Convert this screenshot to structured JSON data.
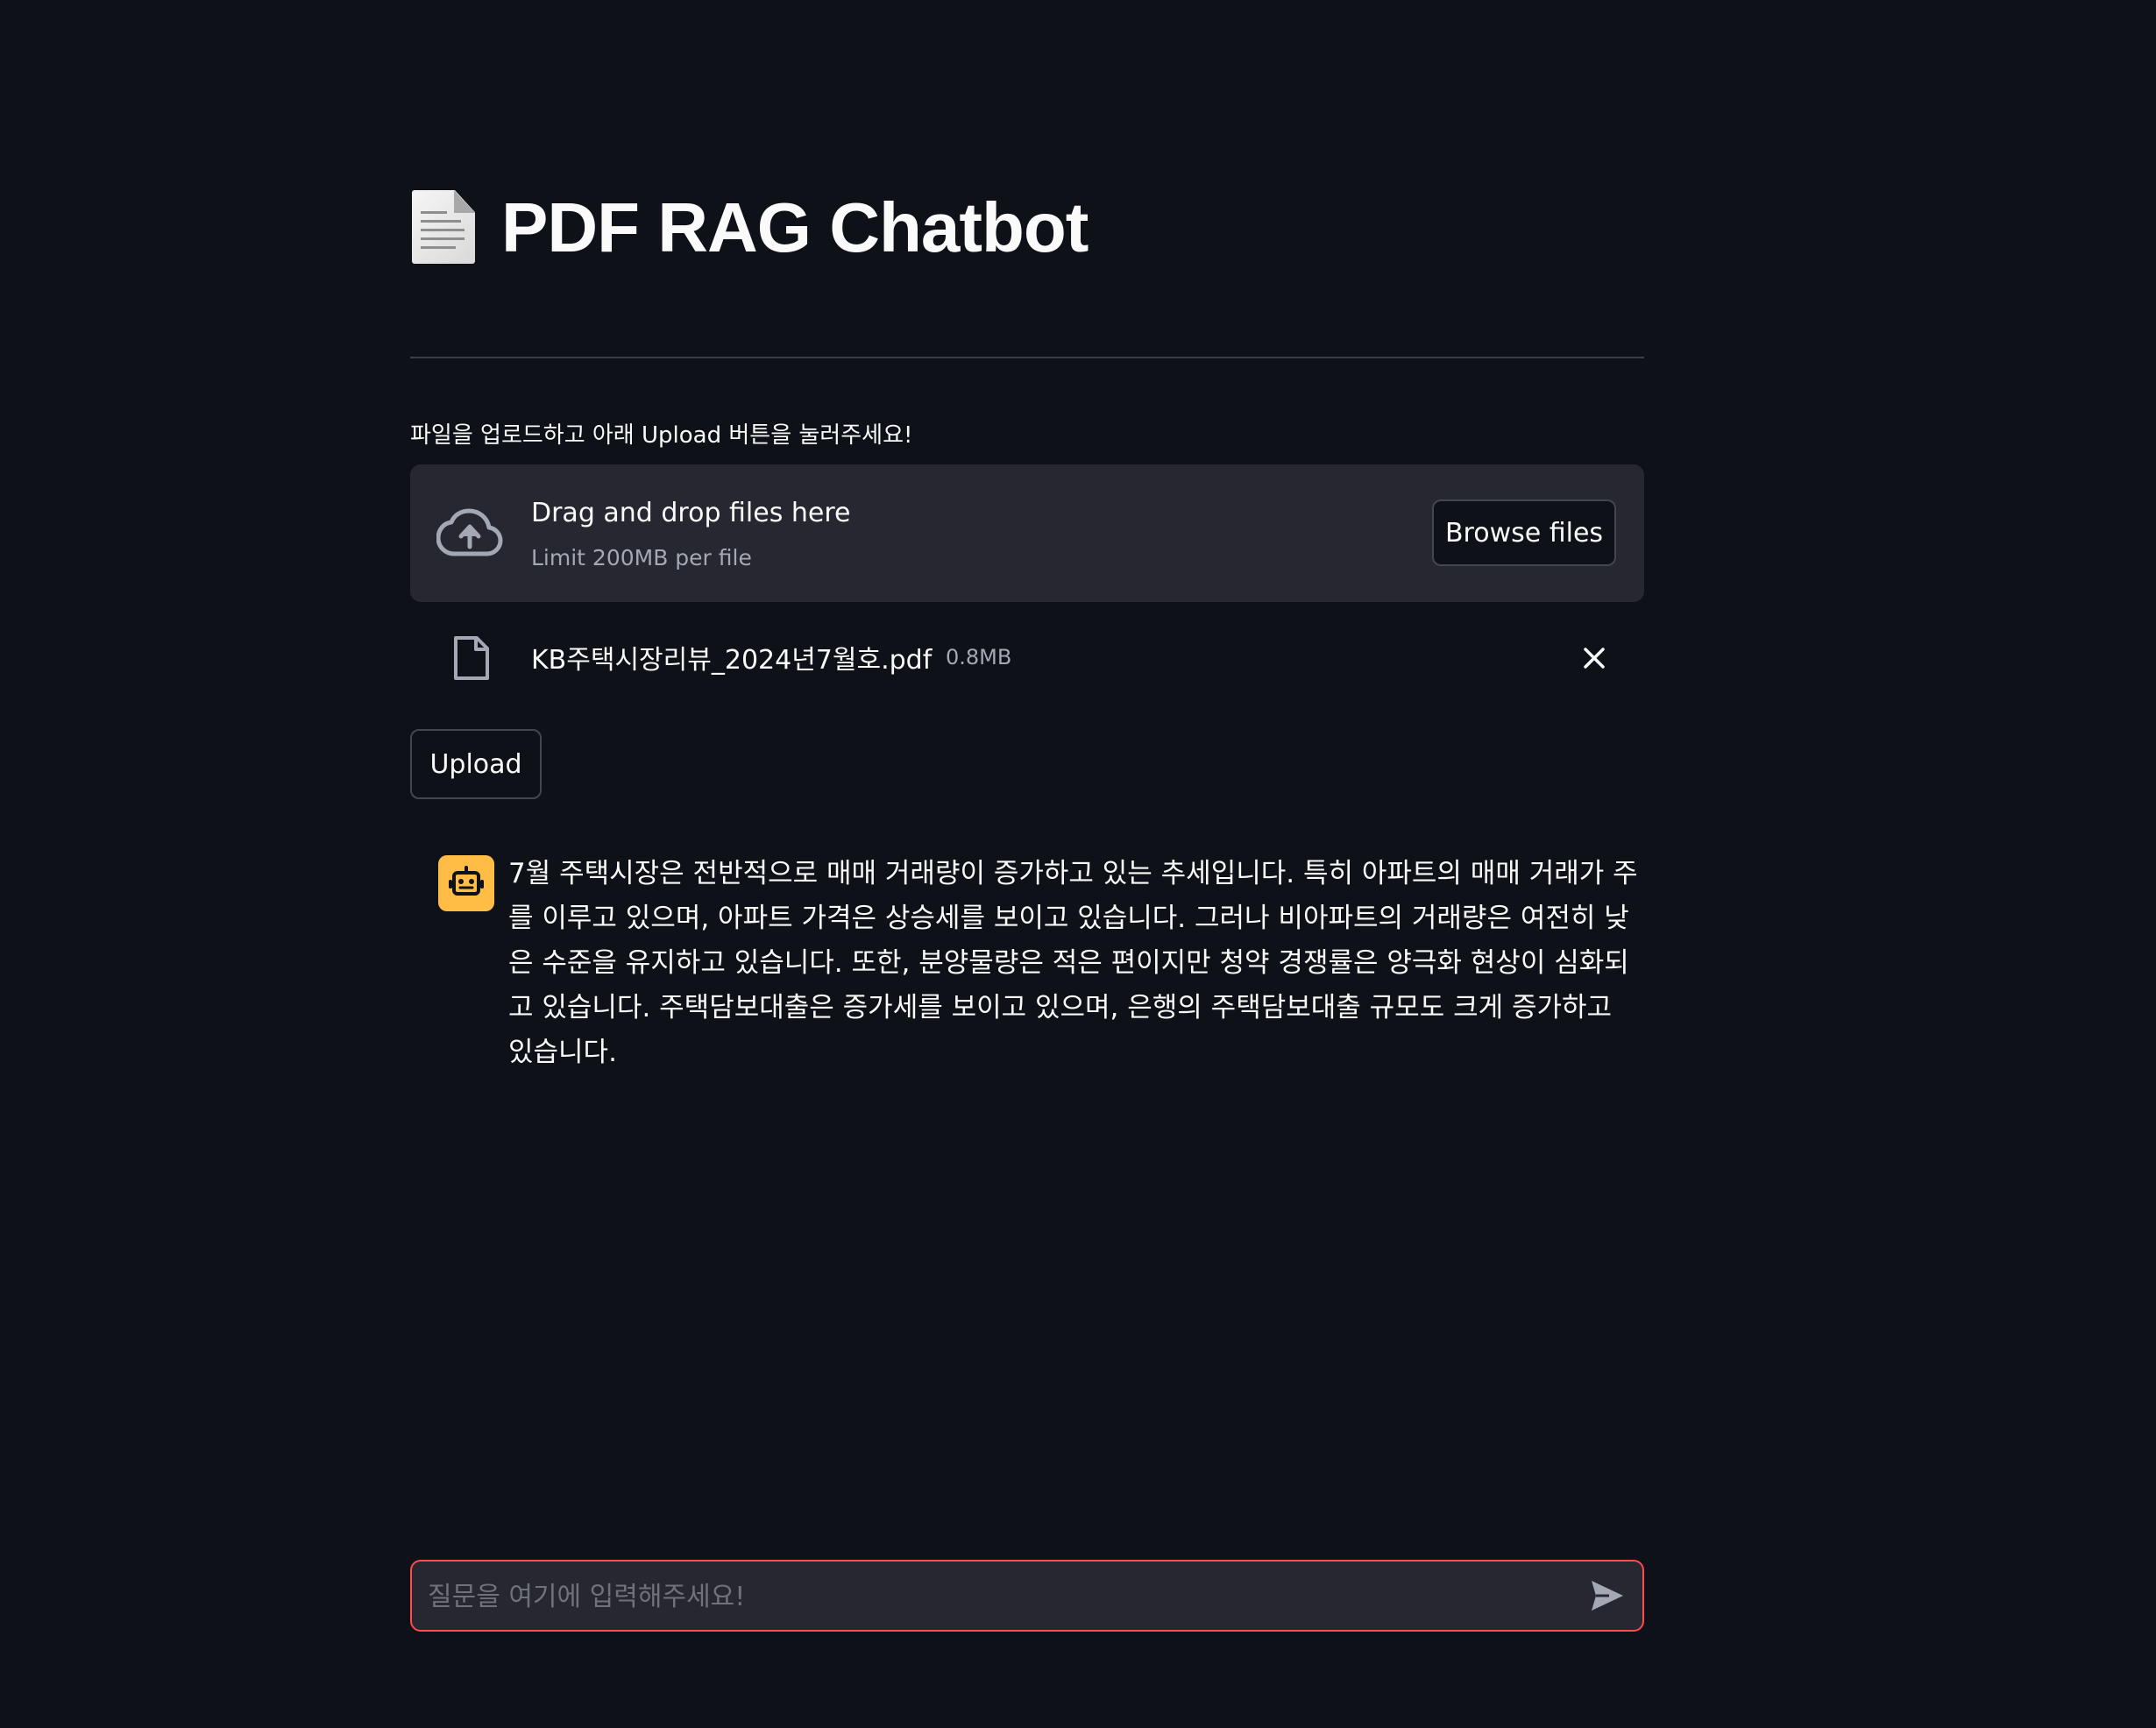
{
  "header": {
    "icon": "page-facing-up-emoji",
    "title": "PDF RAG Chatbot"
  },
  "uploader": {
    "label": "파일을 업로드하고 아래 Upload 버튼을 눌러주세요!",
    "drop_title": "Drag and drop files here",
    "drop_limit": "Limit 200MB per file",
    "browse_label": "Browse files",
    "icon": "cloud-upload-icon"
  },
  "file": {
    "name": "KB주택시장리뷰_2024년7월호.pdf",
    "size": "0.8MB",
    "icon": "file-icon"
  },
  "upload_button": {
    "label": "Upload"
  },
  "chat": {
    "messages": [
      {
        "role": "assistant",
        "avatar": "robot-icon",
        "text": "7월 주택시장은 전반적으로 매매 거래량이 증가하고 있는 추세입니다. 특히 아파트의 매매 거래가 주를 이루고 있으며, 아파트 가격은 상승세를 보이고 있습니다. 그러나 비아파트의 거래량은 여전히 낮은 수준을 유지하고 있습니다. 또한, 분양물량은 적은 편이지만 청약 경쟁률은 양극화 현상이 심화되고 있습니다. 주택담보대출은 증가세를 보이고 있으며, 은행의 주택담보대출 규모도 크게 증가하고 있습니다."
      }
    ],
    "input_placeholder": "질문을 여기에 입력해주세요!",
    "input_value": ""
  },
  "colors": {
    "background": "#0e1117",
    "panel": "#262730",
    "accent": "#ff4b4b",
    "avatar": "#ffbd45",
    "muted_text": "#a3a8b4"
  }
}
